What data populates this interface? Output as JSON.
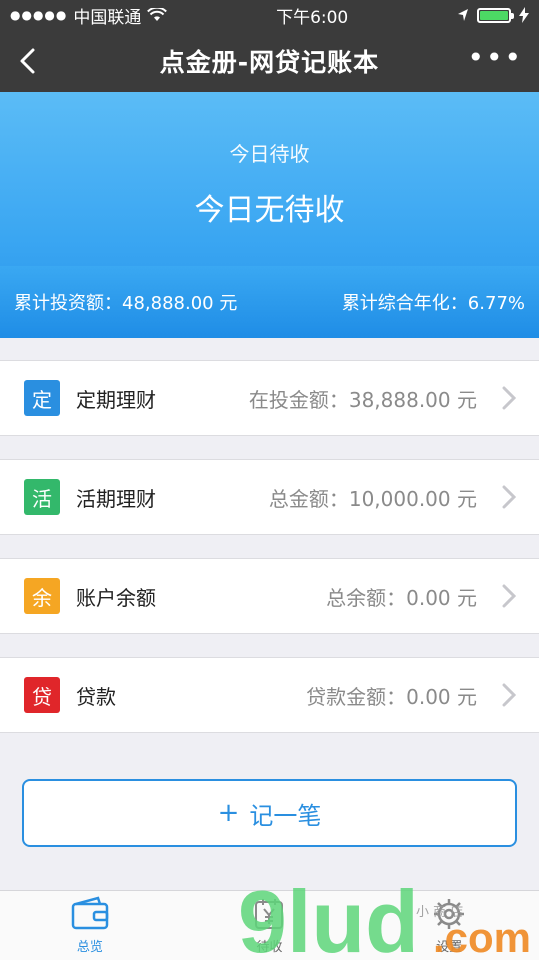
{
  "status_bar": {
    "carrier": "中国联通",
    "time": "下午6:00"
  },
  "nav": {
    "title": "点金册-网贷记账本"
  },
  "hero": {
    "label": "今日待收",
    "value": "今日无待收",
    "total_investment": "累计投资额：48,888.00 元",
    "annualized": "累计综合年化：6.77%"
  },
  "cards": [
    {
      "badge": "定",
      "badge_color": "#2a8fe0",
      "title": "定期理财",
      "amount": "在投金额：38,888.00 元"
    },
    {
      "badge": "活",
      "badge_color": "#33b86b",
      "title": "活期理财",
      "amount": "总金额：10,000.00 元"
    },
    {
      "badge": "余",
      "badge_color": "#f5a623",
      "title": "账户余额",
      "amount": "总余额：0.00 元"
    },
    {
      "badge": "贷",
      "badge_color": "#e0262a",
      "title": "贷款",
      "amount": "贷款金额：0.00 元"
    }
  ],
  "add_button": {
    "label": "记一笔",
    "icon": "plus-icon"
  },
  "tabs": [
    {
      "label": "总览",
      "icon": "wallet-icon",
      "active": true
    },
    {
      "label": "待收",
      "icon": "yen-calendar-icon",
      "active": false
    },
    {
      "label": "设置",
      "icon": "gear-icon",
      "active": false
    }
  ],
  "watermark": {
    "text": "9lud.com",
    "sub": "小 商 店"
  },
  "colors": {
    "accent": "#2a8fe0",
    "nav_bg": "#3b3b3b",
    "page_bg": "#efeff4"
  }
}
